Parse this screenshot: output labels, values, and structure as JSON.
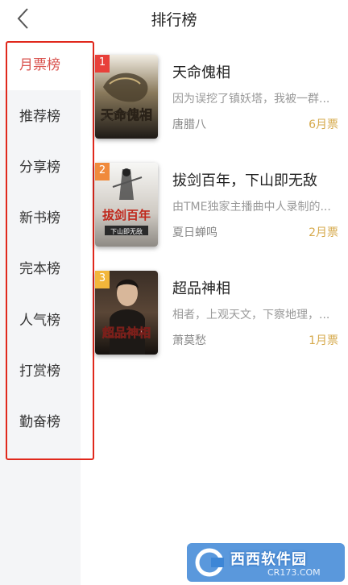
{
  "header": {
    "title": "排行榜"
  },
  "sidebar": {
    "items": [
      {
        "label": "月票榜",
        "active": true
      },
      {
        "label": "推荐榜"
      },
      {
        "label": "分享榜"
      },
      {
        "label": "新书榜"
      },
      {
        "label": "完本榜"
      },
      {
        "label": "人气榜"
      },
      {
        "label": "打赏榜"
      },
      {
        "label": "勤奋榜"
      }
    ]
  },
  "books": [
    {
      "rank": "1",
      "title": "天命傀相",
      "desc": "因为误挖了镇妖塔，我被一群...",
      "author": "唐腊八",
      "votes": "6月票",
      "cover_text": "天命傀相",
      "badge_color": "#e8403a"
    },
    {
      "rank": "2",
      "title": "拔剑百年，下山即无敌",
      "desc": "由TME独家主播曲中人录制的...",
      "author": "夏日蝉鸣",
      "votes": "2月票",
      "cover_text": "拔剑百年",
      "cover_sub": "下山即无敌",
      "badge_color": "#f08a3c"
    },
    {
      "rank": "3",
      "title": "超品神相",
      "desc": "相者，上观天文，下察地理，...",
      "author": "萧莫愁",
      "votes": "1月票",
      "cover_text": "超品神相",
      "badge_color": "#f2b63a"
    }
  ],
  "watermark": {
    "text": "西西软件园",
    "sub": "CR173.COM"
  },
  "colors": {
    "accent": "#d9534f",
    "votes": "#d6a94b",
    "annotation": "#e0281c"
  }
}
